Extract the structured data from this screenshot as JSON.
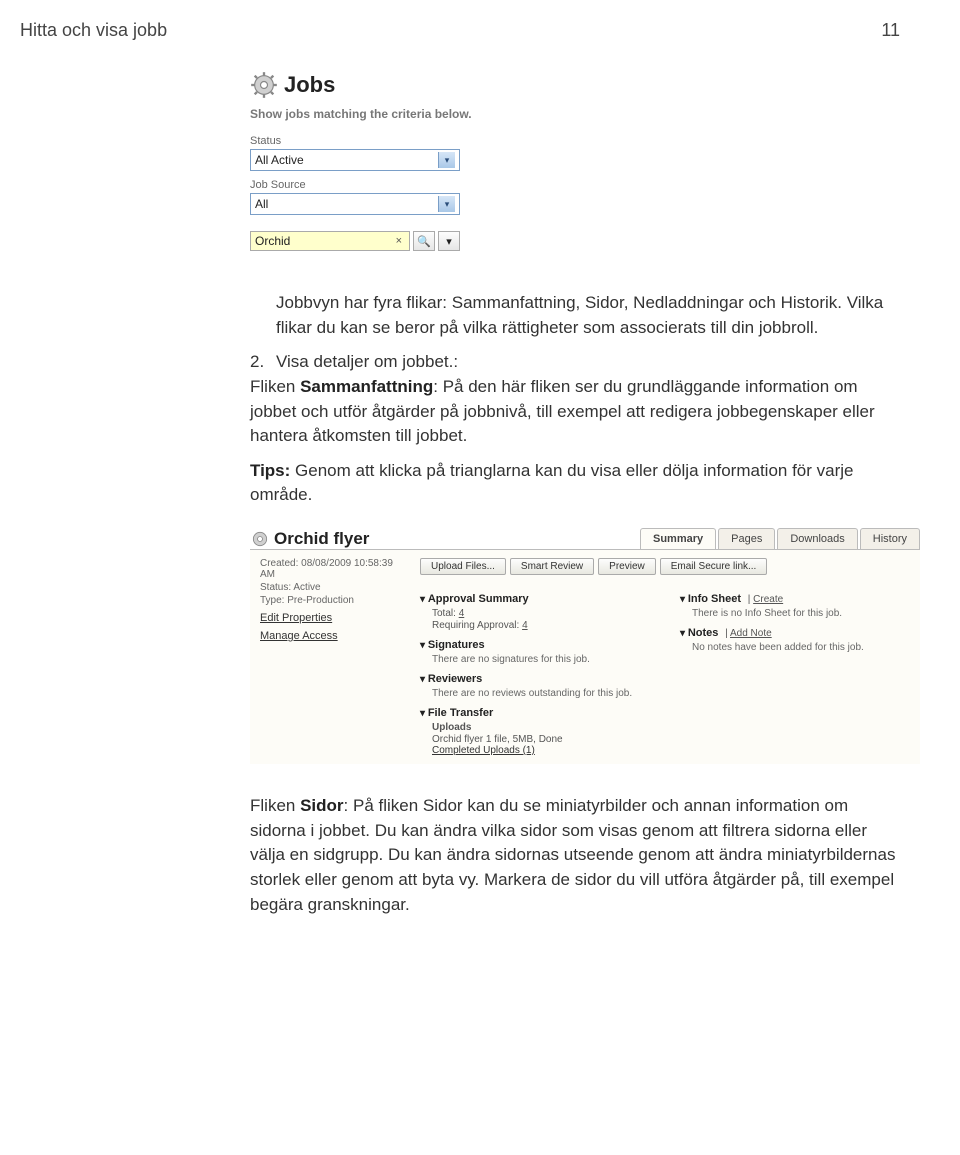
{
  "header": {
    "title": "Hitta och visa jobb",
    "page_number": "11"
  },
  "jobs_panel": {
    "title": "Jobs",
    "subtitle": "Show jobs matching the criteria below.",
    "status_label": "Status",
    "status_value": "All Active",
    "source_label": "Job Source",
    "source_value": "All",
    "search_value": "Orchid",
    "clear_glyph": "×",
    "search_glyph": "🔍",
    "dropdown_glyph": "▾"
  },
  "paragraphs": {
    "p1": "Jobbvyn har fyra flikar: Sammanfattning, Sidor, Nedladdningar och Historik. Vilka flikar du kan se beror på vilka rättigheter som associerats till din jobbroll.",
    "step2_num": "2.",
    "step2": "Visa detaljer om jobbet.:",
    "p2a": "Fliken ",
    "p2b": "Sammanfattning",
    "p2c": ": På den här fliken ser du grundläggande information om jobbet och utför åtgärder på jobbnivå, till exempel att redigera jobbegenskaper eller hantera åtkomsten till jobbet.",
    "tips_label": "Tips:",
    "tips_text": " Genom att klicka på trianglarna kan du visa eller dölja information för varje område.",
    "p3a": "Fliken ",
    "p3b": "Sidor",
    "p3c": ": På fliken Sidor kan du se miniatyrbilder och annan information om sidorna i jobbet. Du kan ändra vilka sidor som visas genom att filtrera sidorna eller välja en sidgrupp. Du kan ändra sidornas utseende genom att ändra miniatyrbildernas storlek eller genom att byta vy. Markera de sidor du vill utföra åtgärder på, till exempel begära granskningar."
  },
  "flyer": {
    "title": "Orchid flyer",
    "tabs": [
      "Summary",
      "Pages",
      "Downloads",
      "History"
    ],
    "active_tab": "Summary",
    "meta": {
      "created_label": "Created:",
      "created_value": "08/08/2009 10:58:39 AM",
      "status_label": "Status:",
      "status_value": "Active",
      "type_label": "Type:",
      "type_value": "Pre-Production",
      "edit_link": "Edit Properties",
      "manage_link": "Manage Access"
    },
    "buttons": [
      "Upload Files...",
      "Smart Review",
      "Preview",
      "Email Secure link..."
    ],
    "approval": {
      "heading": "Approval Summary",
      "total_label": "Total:",
      "total_value": "4",
      "req_label": "Requiring Approval:",
      "req_value": "4"
    },
    "signatures": {
      "heading": "Signatures",
      "text": "There are no signatures for this job."
    },
    "reviewers": {
      "heading": "Reviewers",
      "text": "There are no reviews outstanding for this job."
    },
    "file_transfer": {
      "heading": "File Transfer",
      "uploads_label": "Uploads",
      "upload_line": "Orchid flyer 1 file, 5MB, Done",
      "completed": "Completed Uploads (1)"
    },
    "info_sheet": {
      "heading": "Info Sheet",
      "create": "Create",
      "text": "There is no Info Sheet for this job."
    },
    "notes": {
      "heading": "Notes",
      "add": "Add Note",
      "text": "No notes have been added for this job."
    }
  }
}
